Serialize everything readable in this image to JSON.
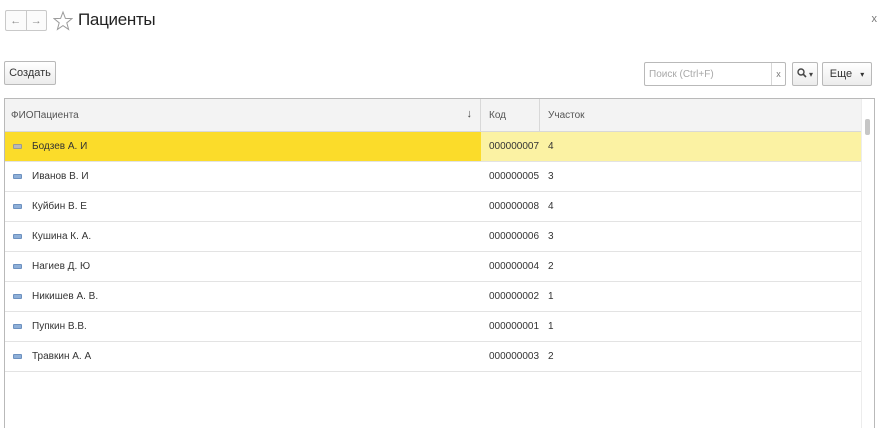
{
  "header": {
    "back_label": "←",
    "forward_label": "→",
    "title": "Пациенты",
    "close_label": "x"
  },
  "toolbar": {
    "create_label": "Создать",
    "search_placeholder": "Поиск (Ctrl+F)",
    "search_value": "",
    "search_clear_label": "x",
    "search_button_icon": "search-icon",
    "more_label": "Еще",
    "more_arrow": "▾"
  },
  "table": {
    "columns": [
      {
        "label": "ФИОПациента",
        "sort": "↓"
      },
      {
        "label": "Код"
      },
      {
        "label": "Участок"
      }
    ],
    "rows": [
      {
        "name": "Бодзев А. И",
        "code": "000000007",
        "area": "4",
        "selected": true
      },
      {
        "name": "Иванов В. И",
        "code": "000000005",
        "area": "3"
      },
      {
        "name": "Куйбин В. Е",
        "code": "000000008",
        "area": "4"
      },
      {
        "name": "Кушина К. А.",
        "code": "000000006",
        "area": "3"
      },
      {
        "name": "Нагиев Д. Ю",
        "code": "000000004",
        "area": "2"
      },
      {
        "name": "Никишев А. В.",
        "code": "000000002",
        "area": "1"
      },
      {
        "name": "Пупкин В.В.",
        "code": "000000001",
        "area": "1"
      },
      {
        "name": "Травкин А. А",
        "code": "000000003",
        "area": "2"
      }
    ]
  },
  "colors": {
    "selected_row": "#fbdc2a",
    "selected_row_light": "#fbf2a3",
    "row_icon": "#8fb0d8"
  }
}
